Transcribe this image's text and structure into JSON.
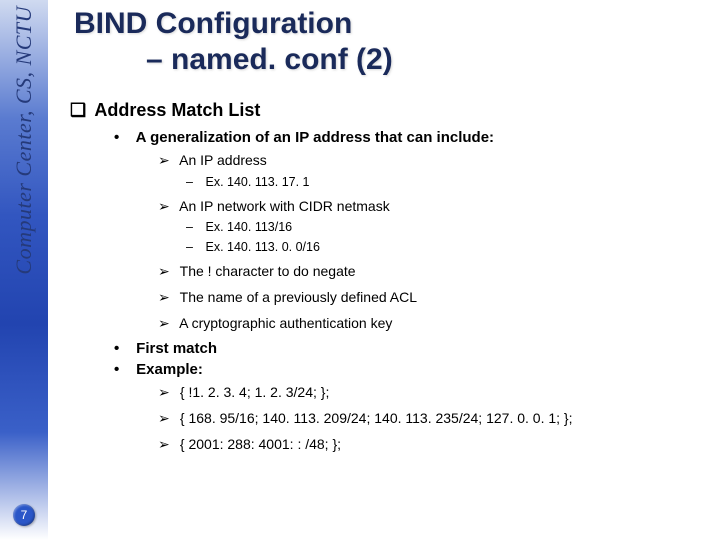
{
  "sidebar": {
    "label": "Computer Center, CS, NCTU"
  },
  "page_number": "7",
  "title": {
    "line1": "BIND Configuration",
    "line2": "– named. conf (2)"
  },
  "section": {
    "heading_marker": "❑",
    "heading": "Address Match List",
    "b1": {
      "marker": "•",
      "text": "A generalization of an IP address that can include:",
      "items": [
        {
          "marker": "➢",
          "text": "An IP address",
          "subs": [
            {
              "marker": "–",
              "text": "Ex. 140. 113. 17. 1"
            }
          ]
        },
        {
          "marker": "➢",
          "text": "An IP network with CIDR netmask",
          "subs": [
            {
              "marker": "–",
              "text": "Ex. 140. 113/16"
            },
            {
              "marker": "–",
              "text": "Ex. 140. 113. 0. 0/16"
            }
          ]
        },
        {
          "marker": "➢",
          "text": "The ! character to do negate",
          "subs": []
        },
        {
          "marker": "➢",
          "text": "The name of a previously defined ACL",
          "subs": []
        },
        {
          "marker": "➢",
          "text": "A cryptographic authentication key",
          "subs": []
        }
      ]
    },
    "b2": {
      "marker": "•",
      "text": "First match"
    },
    "b3": {
      "marker": "•",
      "text": "Example:",
      "items": [
        {
          "marker": "➢",
          "text": "{ !1. 2. 3. 4; 1. 2. 3/24; };"
        },
        {
          "marker": "➢",
          "text": "{ 168. 95/16; 140. 113. 209/24; 140. 113. 235/24; 127. 0. 0. 1; };"
        },
        {
          "marker": "➢",
          "text": "{ 2001: 288: 4001: : /48; };"
        }
      ]
    }
  }
}
